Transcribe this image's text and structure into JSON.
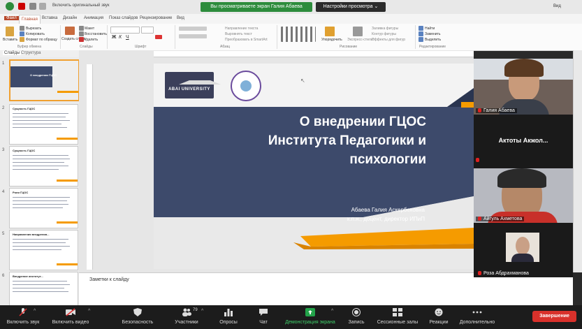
{
  "top": {
    "share_banner": "Вы просматриваете экран Галия Абаева",
    "view_options": "Настройки просмотра ⌄",
    "qat_text": "Включить оригинальный звук",
    "video_label": "Вид"
  },
  "ribbon": {
    "tabs": [
      "Файл",
      "Главная",
      "Вставка",
      "Дизайн",
      "Анимация",
      "Показ слайдов",
      "Рецензирование",
      "Вид"
    ],
    "active_tab": "Главная",
    "groups": {
      "clipboard": "Буфер обмена",
      "slides": "Слайды",
      "font": "Шрифт",
      "paragraph": "Абзац",
      "drawing": "Рисование",
      "editing": "Редактирование"
    },
    "items": {
      "paste": "Вставить",
      "cut": "Вырезать",
      "copy": "Копировать",
      "format_painter": "Формат по образцу",
      "create_slide": "Создать слайд",
      "layout": "Макет",
      "reset": "Восстановить",
      "delete": "Удалить",
      "text_direction": "Направление текста",
      "align_text": "Выровнять текст",
      "smartart": "Преобразовать в SmartArt",
      "arrange": "Упорядочить",
      "quick_styles": "Экспресс-стили",
      "shape_fill": "Заливка фигуры",
      "shape_outline": "Контур фигуры",
      "shape_effects": "Эффекты для фигур",
      "find": "Найти",
      "replace": "Заменить",
      "select": "Выделить"
    }
  },
  "panel": {
    "slides_tab": "Слайды",
    "outline_tab": "Структура"
  },
  "slide": {
    "title_line1": "О внедрении ГЦОС",
    "title_line2": "Института Педагогики и",
    "title_line3": "психологии",
    "author": "Абаева Галия Аскербековна",
    "author_title": "к.п.н., доцент, директор ИПиП",
    "logo_text": "ABAI UNIVERSITY"
  },
  "thumbnails": [
    {
      "num": "1",
      "title": "О внедрении ГЦОС"
    },
    {
      "num": "2",
      "title": "Сущность ГЦОС"
    },
    {
      "num": "3",
      "title": "Сущность ГЦОС"
    },
    {
      "num": "4",
      "title": "Роли ГЦОС"
    },
    {
      "num": "5",
      "title": "Направления внедрения..."
    },
    {
      "num": "6",
      "title": "Внедрение институт..."
    }
  ],
  "notes_placeholder": "Заметки к слайду",
  "participants": [
    {
      "name": "Галия Абаева"
    },
    {
      "name": "Актоты Акжол..."
    },
    {
      "name": "Айгуль Ахметова"
    },
    {
      "name": "Роза Абдрахманова"
    }
  ],
  "toolbar": {
    "unmute": "Включить звук",
    "start_video": "Включить видео",
    "security": "Безопасность",
    "participants": "Участники",
    "participants_count": "79",
    "polls": "Опросы",
    "chat": "Чат",
    "share_screen": "Демонстрация экрана",
    "record": "Запись",
    "breakout": "Сессионные залы",
    "reactions": "Реакции",
    "more": "Дополнительно",
    "end": "Завершение"
  },
  "colors": {
    "zoom_green": "#2d8c3c",
    "slide_navy": "#3d4a6b",
    "slide_orange": "#f59b00",
    "end_red": "#d9312b",
    "ppt_accent": "#b7472a"
  }
}
